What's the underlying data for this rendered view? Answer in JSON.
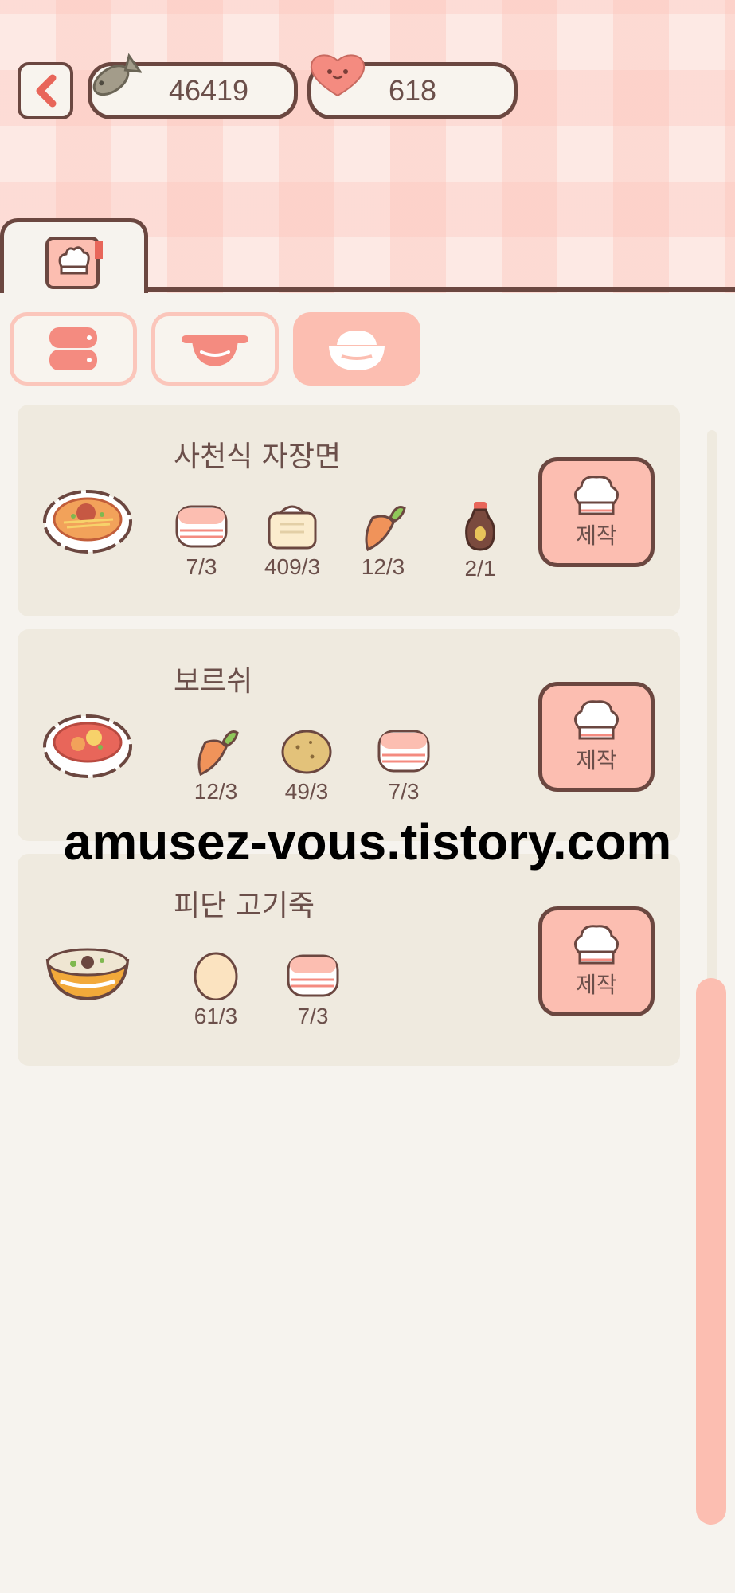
{
  "currency": {
    "fish": "46419",
    "hearts": "618"
  },
  "recipes": [
    {
      "name": "사천식 자장면",
      "ingredients": [
        {
          "icon": "meat-icon",
          "count": "7/3"
        },
        {
          "icon": "flour-icon",
          "count": "409/3"
        },
        {
          "icon": "carrot-icon",
          "count": "12/3"
        },
        {
          "icon": "soy-sauce-icon",
          "count": "2/1"
        }
      ],
      "button": "제작"
    },
    {
      "name": "보르쉬",
      "ingredients": [
        {
          "icon": "carrot-icon",
          "count": "12/3"
        },
        {
          "icon": "potato-icon",
          "count": "49/3"
        },
        {
          "icon": "meat-icon",
          "count": "7/3"
        }
      ],
      "button": "제작"
    },
    {
      "name": "피단 고기죽",
      "ingredients": [
        {
          "icon": "egg-icon",
          "count": "61/3"
        },
        {
          "icon": "meat-icon",
          "count": "7/3"
        }
      ],
      "button": "제작"
    }
  ],
  "watermark": "amusez-vous.tistory.com",
  "colors": {
    "accent": "#fcbeb1",
    "outline": "#6b4740",
    "card": "#efeadf",
    "background": "#f6f3ee"
  }
}
